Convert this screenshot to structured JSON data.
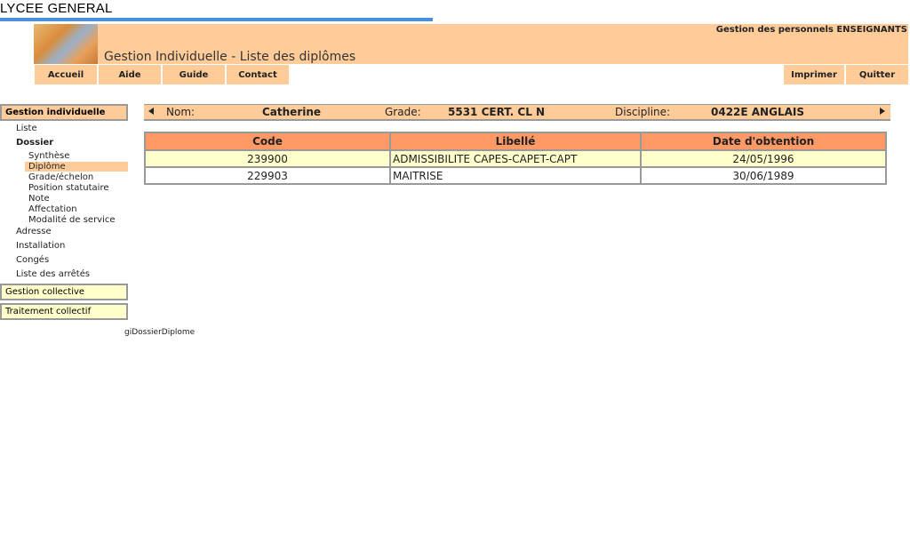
{
  "site": {
    "title": "LYCEE GENERAL"
  },
  "header": {
    "page_title": "Gestion Individuelle - Liste des diplômes",
    "right_label": "Gestion des personnels ENSEIGNANTS"
  },
  "topnav": {
    "left": [
      "Accueil",
      "Aide",
      "Guide",
      "Contact"
    ],
    "right": [
      "Imprimer",
      "Quitter"
    ]
  },
  "sidebar": {
    "gestion_individuelle": "Gestion individuelle",
    "items": [
      "Liste",
      "Dossier"
    ],
    "dossier_subitems": [
      "Synthèse",
      "Diplôme",
      "Grade/échelon",
      "Position statutaire",
      "Note",
      "Affectation",
      "Modalité de service"
    ],
    "more_items": [
      "Adresse",
      "Installation",
      "Congés",
      "Liste des arrêtés"
    ],
    "gestion_collective": "Gestion collective",
    "traitement_collectif": "Traitement collectif"
  },
  "person": {
    "nom_label": "Nom:",
    "nom_value": "Catherine",
    "grade_label": "Grade:",
    "grade_value": "5531 CERT. CL N",
    "discipline_label": "Discipline:",
    "discipline_value": "0422E ANGLAIS"
  },
  "table": {
    "headers": [
      "Code",
      "Libellé",
      "Date d'obtention"
    ],
    "rows": [
      [
        "239900",
        "ADMISSIBILITE CAPES-CAPET-CAPT",
        "24/05/1996"
      ],
      [
        "229903",
        "MAITRISE",
        "30/06/1989"
      ]
    ]
  },
  "footer": {
    "code": "giDossierDiplome"
  },
  "colors": {
    "header_bg": "#ffcc99",
    "table_header_bg": "#ff9966",
    "highlight_row": "#ffffcc",
    "accent_bar": "#4a8fd9"
  }
}
